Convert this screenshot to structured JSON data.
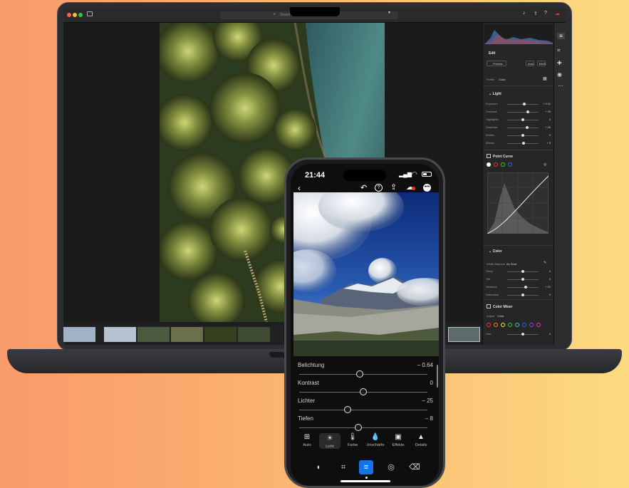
{
  "laptop": {
    "search_placeholder": "Search",
    "panel": {
      "edit_title": "Edit",
      "presets_label": "Presets",
      "auto_label": "Auto",
      "bw_label": "B&W",
      "profile_label": "Profile",
      "profile_value": "Color",
      "light_title": "Light",
      "light_sliders": [
        {
          "label": "Exposure",
          "value": "+ 0.11",
          "level": 0.55
        },
        {
          "label": "Contrast",
          "value": "+ 30",
          "level": 0.65
        },
        {
          "label": "Highlights",
          "value": "0",
          "level": 0.5
        },
        {
          "label": "Shadows",
          "value": "+ 26",
          "level": 0.63
        },
        {
          "label": "Whites",
          "value": "0",
          "level": 0.5
        },
        {
          "label": "Blacks",
          "value": "+ 5",
          "level": 0.52
        }
      ],
      "point_curve_title": "Point Curve",
      "color_title": "Color",
      "white_balance_label": "White Balance",
      "white_balance_value": "As Shot",
      "color_sliders": [
        {
          "label": "Temp",
          "value": "0",
          "level": 0.5
        },
        {
          "label": "Tint",
          "value": "0",
          "level": 0.5
        },
        {
          "label": "Vibrance",
          "value": "+ 22",
          "level": 0.6
        },
        {
          "label": "Saturation",
          "value": "0",
          "level": 0.5
        }
      ],
      "color_mixer_title": "Color Mixer",
      "adjust_label": "Adjust",
      "adjust_value": "Color",
      "hue_label": "Hue",
      "hue_value": "0",
      "hue_level": 0.5
    }
  },
  "phone": {
    "time": "21:44",
    "adjustments": [
      {
        "label": "Belichtung",
        "value": "– 0.64",
        "level": 0.47
      },
      {
        "label": "Kontrast",
        "value": "0",
        "level": 0.5
      },
      {
        "label": "Lichter",
        "value": "– 25",
        "level": 0.38
      },
      {
        "label": "Tiefen",
        "value": "– 8",
        "level": 0.46
      }
    ],
    "tabs": [
      {
        "label": "Auto",
        "icon": "auto-icon"
      },
      {
        "label": "Licht",
        "icon": "sun-icon",
        "active": true
      },
      {
        "label": "Farbe",
        "icon": "thermometer-icon"
      },
      {
        "label": "Unschärfe",
        "icon": "drop-icon"
      },
      {
        "label": "Effekte",
        "icon": "effects-icon"
      },
      {
        "label": "Details",
        "icon": "triangle-icon"
      }
    ]
  },
  "colors": {
    "accent": "#1473e6",
    "background_left": "#f99a6a",
    "background_right": "#fddb82"
  }
}
